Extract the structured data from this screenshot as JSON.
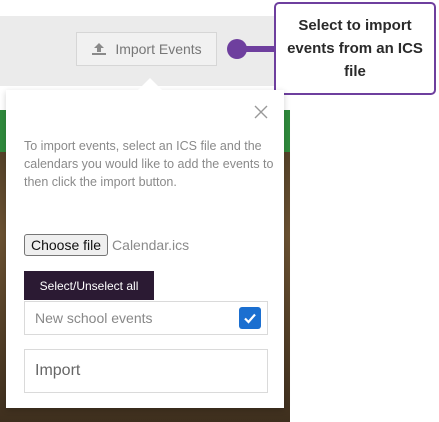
{
  "toolbar": {
    "import_events_label": "Import Events",
    "import_icon": "upload-icon"
  },
  "callout": {
    "text": "Select to import events from an ICS file",
    "border_color": "#6e3f9e"
  },
  "modal": {
    "instructions": "To import events, select an ICS file and the calendars you would like to add the events to then click the import button.",
    "choose_file_label": "Choose file",
    "file_name": "Calendar.ics",
    "select_all_label": "Select/Unselect all",
    "calendars": [
      {
        "name": "New school events",
        "checked": true
      }
    ],
    "import_label": "Import",
    "close_icon": "close-icon"
  },
  "colors": {
    "accent": "#2b1a33",
    "checkbox": "#1b6fd0",
    "green": "#2f8a3c"
  }
}
